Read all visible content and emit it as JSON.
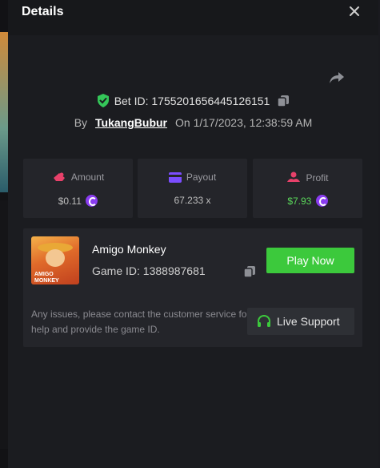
{
  "modal": {
    "title": "Details",
    "close_icon": "close-icon",
    "share_icon": "share-icon"
  },
  "bet": {
    "label": "Bet ID:",
    "id": "1755201656445126151",
    "by_label": "By",
    "user": "TukangBubur",
    "on_label": "On",
    "datetime": "1/17/2023, 12:38:59 AM"
  },
  "stats": [
    {
      "label": "Amount",
      "value": "$0.11",
      "icon": "amount-icon",
      "value_color": "#bdbdbd"
    },
    {
      "label": "Payout",
      "value": "67.233 x",
      "icon": "payout-icon",
      "value_color": "#bdbdbd"
    },
    {
      "label": "Profit",
      "value": "$7.93",
      "icon": "profit-icon",
      "value_color": "#5ad65a"
    }
  ],
  "game": {
    "name": "Amigo Monkey",
    "id_label": "Game ID:",
    "id": "1388987681",
    "thumb_text_1": "AMIGO",
    "thumb_text_2": "MONKEY",
    "play_label": "Play Now",
    "issue_text": "Any issues, please contact the customer service for help and provide the game ID.",
    "support_label": "Live Support"
  },
  "colors": {
    "accent_green": "#3cc93c",
    "shield_green": "#34c759",
    "amount_icon": "#e8416a",
    "payout_icon": "#7b4dff",
    "profit_icon": "#e8416a"
  }
}
